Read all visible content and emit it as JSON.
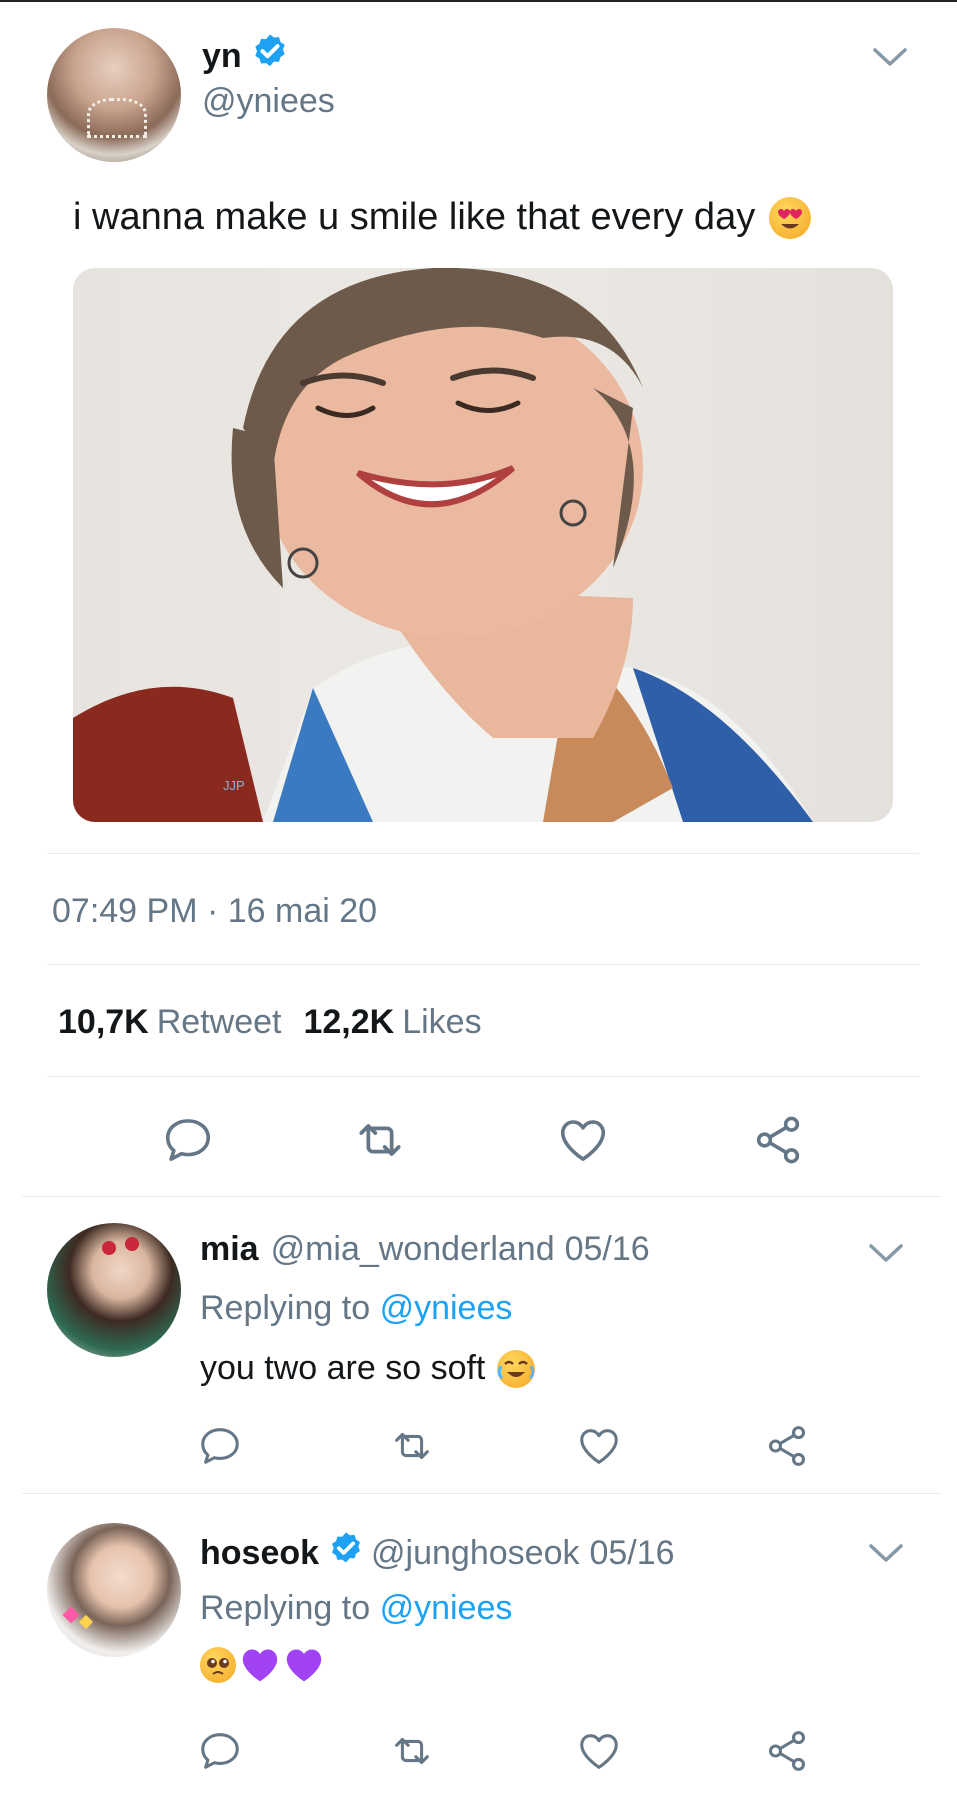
{
  "tweet": {
    "name": "yn",
    "handle": "@yniees",
    "text": "i wanna make u smile like that every day",
    "timestamp": "07:49 PM · 16 mai 20",
    "retweet_count": "10,7K",
    "retweet_label": "Retweet",
    "likes_count": "12,2K",
    "likes_label": "Likes",
    "photo_watermark": "JJP"
  },
  "replies": [
    {
      "name": "mia",
      "handle": "@mia_wonderland",
      "date": "05/16",
      "replying_label": "Replying to",
      "replying_to": "@yniees",
      "text": "you two are so soft"
    },
    {
      "name": "hoseok",
      "handle": "@junghoseok",
      "date": "05/16",
      "replying_label": "Replying to",
      "replying_to": "@yniees",
      "text": ""
    }
  ],
  "icons": {
    "verified": "verified-badge-icon",
    "chevron": "chevron-down-icon",
    "reply": "reply-icon",
    "retweet": "retweet-icon",
    "like": "heart-icon",
    "share": "share-icon"
  },
  "colors": {
    "accent": "#1da1f2",
    "secondary_text": "#657786",
    "divider": "#e6ecf0",
    "purple_heart": "#a142f4"
  }
}
